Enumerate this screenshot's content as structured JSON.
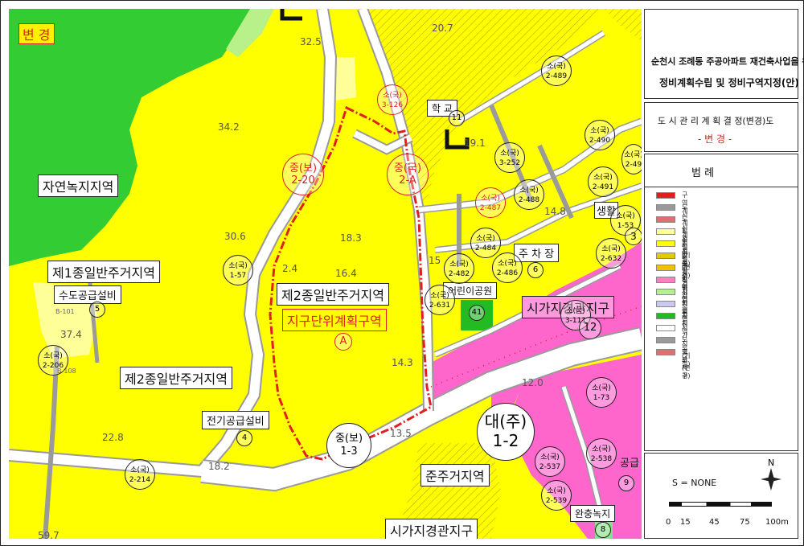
{
  "badge": {
    "change": "변 경"
  },
  "zones": {
    "natural_green": "자연녹지지역",
    "residential_1": "제1종일반주거지역",
    "residential_2a": "제2종일반주거지역",
    "residential_2b": "제2종일반주거지역",
    "semi_residential": "준주거지역",
    "district_plan": "지구단위계획구역",
    "district_mark": "A",
    "urban_landscape_1": "시가지경관지구",
    "urban_landscape_2": "시가지경관지구"
  },
  "facilities": {
    "water_supply": "수도공급설비",
    "power_supply": "전기공급설비",
    "parking": "주 차 장",
    "kids_park": "어린이공원",
    "school": "학  교",
    "buffer_green": "완충녹지",
    "supply": "공급"
  },
  "road_codes": {
    "c1": {
      "a": "중(보)",
      "b": "2-20"
    },
    "c2": {
      "a": "중(국)",
      "b": "2-A"
    },
    "c3": {
      "a": "중(보)",
      "b": "1-3"
    },
    "c4": {
      "a": "대(주)",
      "b": "1-2"
    },
    "s1": {
      "a": "소(국)",
      "b": "3-126"
    },
    "s2": {
      "a": "소(국)",
      "b": "2-489"
    },
    "s3": {
      "a": "소(국)",
      "b": "2-490"
    },
    "s4": {
      "a": "소(국)",
      "b": "2-491"
    },
    "s5": {
      "a": "소(국)",
      "b": "2-49"
    },
    "s6": {
      "a": "소(국)",
      "b": "3-252"
    },
    "s7": {
      "a": "소(국)",
      "b": "2-488"
    },
    "s8": {
      "a": "소(국)",
      "b": "2-487"
    },
    "s9": {
      "a": "소(국)",
      "b": "2-484"
    },
    "s10": {
      "a": "소(국)",
      "b": "2-482"
    },
    "s11": {
      "a": "소(국)",
      "b": "2-486"
    },
    "s12": {
      "a": "소(국)",
      "b": "2-632"
    },
    "s13": {
      "a": "소(국)",
      "b": "2-631"
    },
    "s14": {
      "a": "소(국)",
      "b": "3-111"
    },
    "s15": {
      "a": "소(국)",
      "b": "1-57"
    },
    "s16": {
      "a": "소(국)",
      "b": "2-206"
    },
    "s17": {
      "a": "소(국)",
      "b": "2-214"
    },
    "s18": {
      "a": "소(국)",
      "b": "1-73"
    },
    "s19": {
      "a": "소(국)",
      "b": "2-537"
    },
    "s20": {
      "a": "소(국)",
      "b": "2-538"
    },
    "s21": {
      "a": "소(국)",
      "b": "2-539"
    },
    "s22": {
      "a": "소(국)",
      "b": "1-53"
    }
  },
  "numbers": {
    "n11": "11",
    "n12": "12",
    "n3": "3",
    "n5": "5",
    "n4": "4",
    "n6": "6",
    "n8": "8",
    "n9": "9",
    "n41": "41"
  },
  "elevations": {
    "e1": "32.5",
    "e2": "20.7",
    "e3": "34.2",
    "e4": "30.6",
    "e5": "18.3",
    "e6": "16.4",
    "e7": "37.4",
    "e8": "22.8",
    "e9": "18.2",
    "e10": "14.3",
    "e11": "12.0",
    "e12": "13.5",
    "e13": "14.8",
    "e14": "19.1",
    "e15": "59.7",
    "e16": "2.4",
    "e17": "15"
  },
  "parcels": {
    "p1": "B-101",
    "p2": "B-108"
  },
  "panel": {
    "title_line1": "순천시 조례동 주공아파트 재건축사업을 위한",
    "title_line2": "정비계획수립 및 정비구역지정(안)",
    "decision": "도 시 관 리 계 획 결 정(변경)도",
    "change": "- 변 경 -",
    "legend_title": "범      례",
    "legend": [
      {
        "label": "구역계",
        "color": "#e02020"
      },
      {
        "label": "도시계획시설(기정)",
        "color": "#9a9a9a"
      },
      {
        "label": "도시계획시설(변경)",
        "color": "#e07070"
      },
      {
        "label": "1종일반주거지역",
        "color": "#ffff99"
      },
      {
        "label": "2종일반주거지역",
        "color": "#ffff00"
      },
      {
        "label": "3종일반주거지역",
        "color": "#e6c800"
      },
      {
        "label": "준주거지역",
        "color": "#f2c200"
      },
      {
        "label": "일반상업지역",
        "color": "#ff80c0"
      },
      {
        "label": "자연녹지지역",
        "color": "#b8f08a"
      },
      {
        "label": "학    교",
        "color": "#c8c8f0"
      },
      {
        "label": "공    원",
        "color": "#22bb22"
      },
      {
        "label": "시가지경관지구",
        "color": "#ffffff"
      },
      {
        "label": "도로(기정)",
        "color": "#9a9a9a"
      },
      {
        "label": "도로(변경)",
        "color": "#e07070"
      }
    ],
    "scale_text": "S = NONE",
    "north": "N",
    "scale_ticks": [
      "0",
      "15",
      "45",
      "75",
      "100m"
    ]
  },
  "colors": {
    "green": "#33cc33",
    "yellow": "#ffff00",
    "light_yellow": "#ffff99",
    "pink": "#ff66cc",
    "red": "#e02020"
  }
}
